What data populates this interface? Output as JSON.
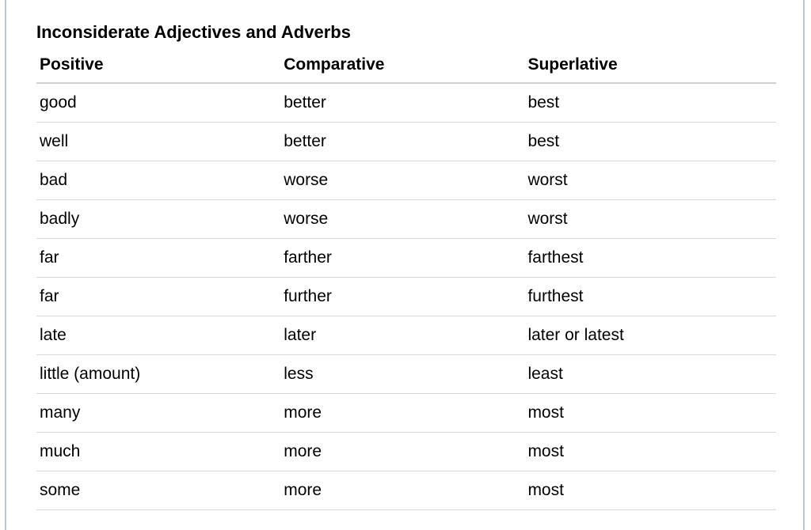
{
  "title": "Inconsiderate Adjectives and Adverbs",
  "headers": {
    "col1": "Positive",
    "col2": "Comparative",
    "col3": "Superlative"
  },
  "chart_data": {
    "type": "table",
    "columns": [
      "Positive",
      "Comparative",
      "Superlative"
    ],
    "rows": [
      [
        "good",
        "better",
        "best"
      ],
      [
        "well",
        "better",
        "best"
      ],
      [
        "bad",
        "worse",
        "worst"
      ],
      [
        "badly",
        "worse",
        "worst"
      ],
      [
        "far",
        "farther",
        "farthest"
      ],
      [
        "far",
        "further",
        "furthest"
      ],
      [
        "late",
        "later",
        "later or latest"
      ],
      [
        "little (amount)",
        "less",
        "least"
      ],
      [
        "many",
        "more",
        "most"
      ],
      [
        "much",
        "more",
        "most"
      ],
      [
        "some",
        "more",
        "most"
      ]
    ]
  }
}
